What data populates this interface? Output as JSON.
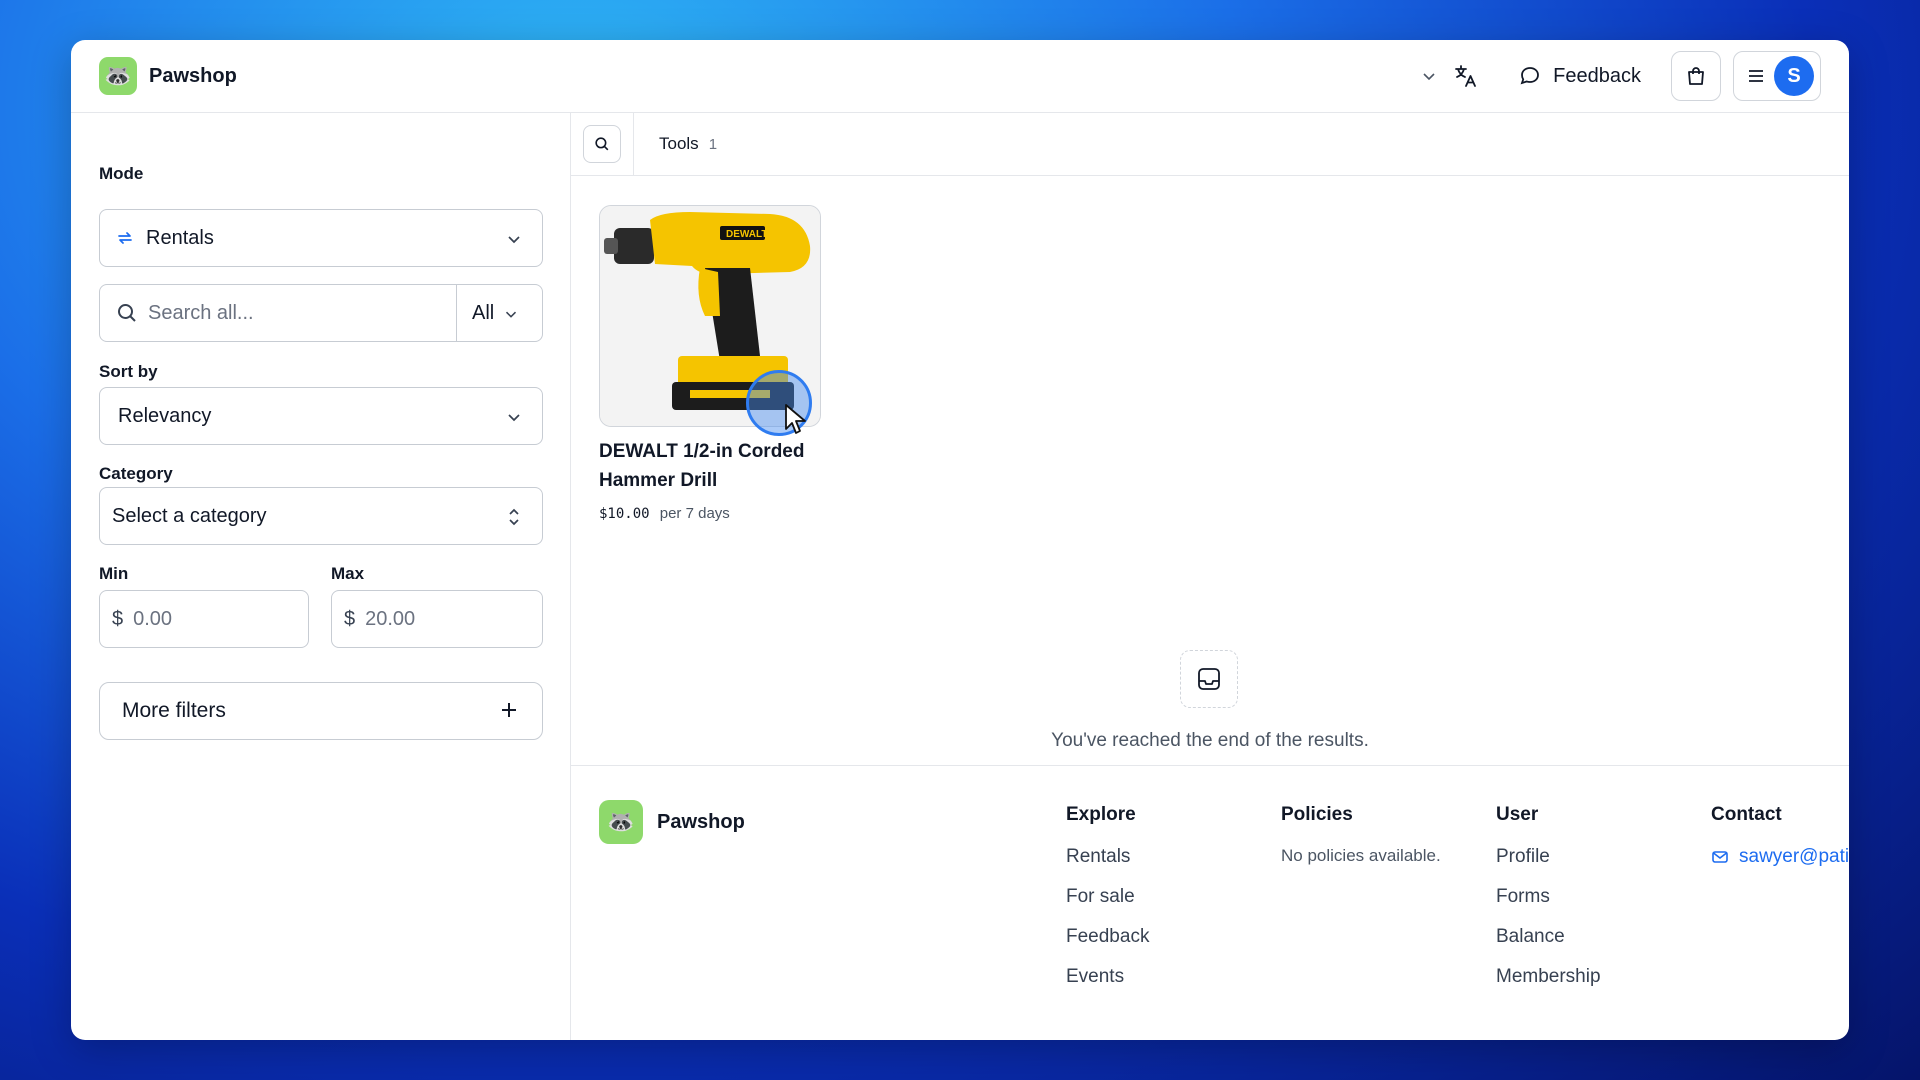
{
  "header": {
    "brand_name": "Pawshop",
    "feedback_label": "Feedback",
    "avatar_initial": "S"
  },
  "sidebar": {
    "mode_label": "Mode",
    "mode_value": "Rentals",
    "search_placeholder": "Search all...",
    "search_scope": "All",
    "sort_label": "Sort by",
    "sort_value": "Relevancy",
    "category_label": "Category",
    "category_placeholder": "Select a category",
    "min_label": "Min",
    "max_label": "Max",
    "currency_symbol": "$",
    "min_placeholder": "0.00",
    "max_placeholder": "20.00",
    "more_filters_label": "More filters"
  },
  "main": {
    "tab_label": "Tools",
    "tab_count": "1",
    "products": [
      {
        "title": "DEWALT 1/2-in Corded Hammer Drill",
        "price": "$10.00",
        "period": "per 7 days"
      }
    ],
    "end_message": "You've reached the end of the results."
  },
  "footer": {
    "brand_name": "Pawshop",
    "explore": {
      "heading": "Explore",
      "items": [
        "Rentals",
        "For sale",
        "Feedback",
        "Events"
      ]
    },
    "policies": {
      "heading": "Policies",
      "note": "No policies available."
    },
    "user": {
      "heading": "User",
      "items": [
        "Profile",
        "Forms",
        "Balance",
        "Membership"
      ]
    },
    "contact": {
      "heading": "Contact",
      "email": "sawyer@patio...."
    }
  },
  "colors": {
    "accent": "#1d6cf0",
    "logo_bg": "#8ed96b"
  }
}
